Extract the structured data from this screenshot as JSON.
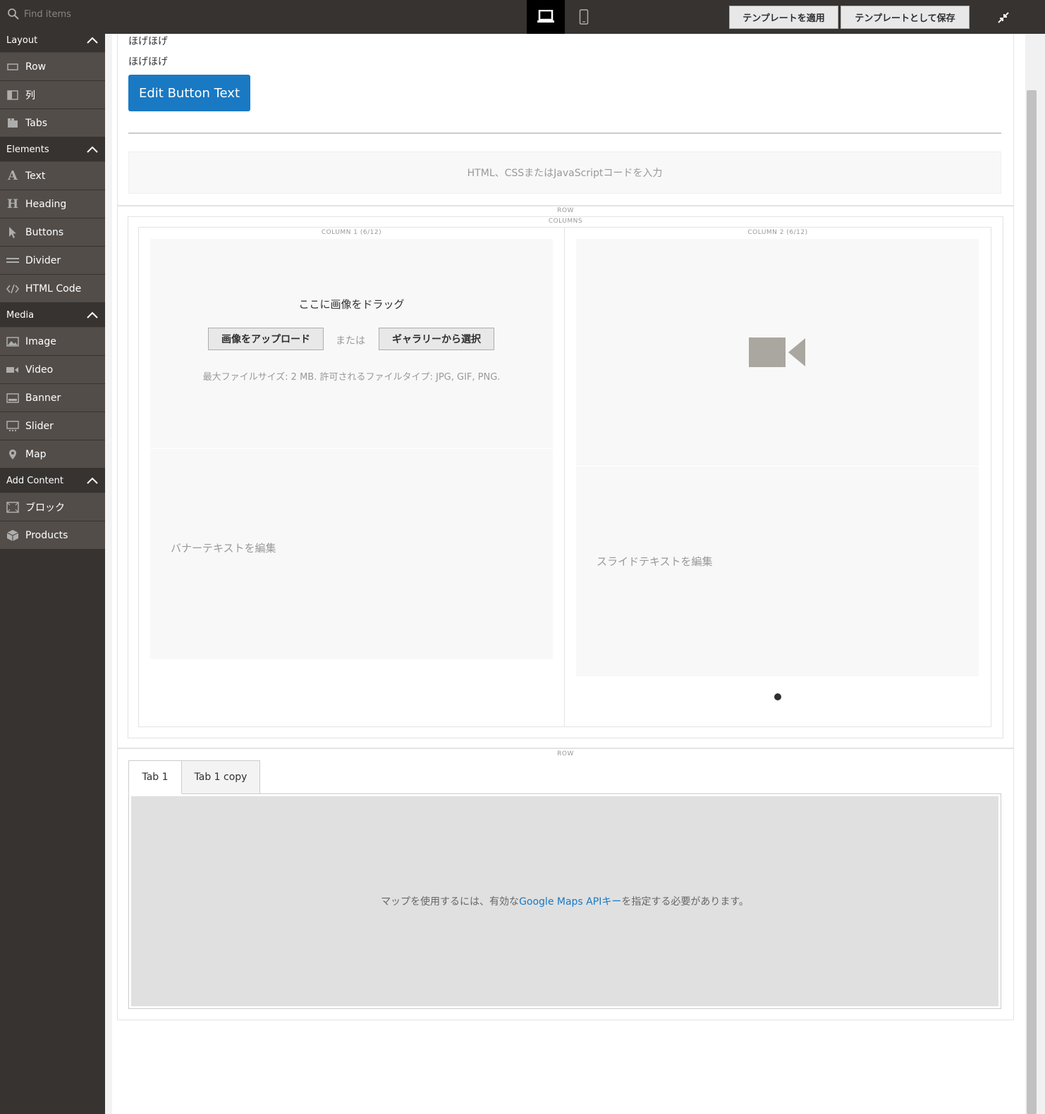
{
  "search": {
    "placeholder": "Find items"
  },
  "toolbar": {
    "apply_template": "テンプレートを適用",
    "save_as_template": "テンプレートとして保存"
  },
  "sidebar": {
    "groups": [
      {
        "label": "Layout",
        "items": [
          {
            "label": "Row",
            "icon": "row-icon"
          },
          {
            "label": "列",
            "icon": "column-icon"
          },
          {
            "label": "Tabs",
            "icon": "tabs-icon"
          }
        ]
      },
      {
        "label": "Elements",
        "items": [
          {
            "label": "Text",
            "icon": "text-icon"
          },
          {
            "label": "Heading",
            "icon": "heading-icon"
          },
          {
            "label": "Buttons",
            "icon": "cursor-icon"
          },
          {
            "label": "Divider",
            "icon": "divider-icon"
          },
          {
            "label": "HTML Code",
            "icon": "code-icon"
          }
        ]
      },
      {
        "label": "Media",
        "items": [
          {
            "label": "Image",
            "icon": "image-icon"
          },
          {
            "label": "Video",
            "icon": "video-icon"
          },
          {
            "label": "Banner",
            "icon": "banner-icon"
          },
          {
            "label": "Slider",
            "icon": "slider-icon"
          },
          {
            "label": "Map",
            "icon": "map-pin-icon"
          }
        ]
      },
      {
        "label": "Add Content",
        "items": [
          {
            "label": "ブロック",
            "icon": "block-icon"
          },
          {
            "label": "Products",
            "icon": "products-icon"
          }
        ]
      }
    ]
  },
  "stage": {
    "text_lines": [
      "ほげほげ",
      "ほげほげ"
    ],
    "button_text": "Edit Button Text",
    "html_placeholder": "HTML、CSSまたはJavaScriptコードを入力",
    "row_label": "ROW",
    "columns_label": "COLUMNS",
    "column1_label": "COLUMN 1 (6/12)",
    "column2_label": "COLUMN 2 (6/12)",
    "image": {
      "drag_text": "ここに画像をドラッグ",
      "upload_button": "画像をアップロード",
      "or_text": "または",
      "gallery_button": "ギャラリーから選択",
      "max_text": "最大ファイルサイズ: 2 MB. 許可されるファイルタイプ: JPG, GIF, PNG."
    },
    "banner_text": "バナーテキストを編集",
    "slide_text": "スライドテキストを編集",
    "row2_label": "ROW",
    "tabs": [
      "Tab 1",
      "Tab 1 copy"
    ],
    "map": {
      "prefix": "マップを使用するには、有効な",
      "link": "Google Maps APIキー",
      "suffix": "を指定する必要があります。"
    }
  },
  "colors": {
    "sidebar_bg": "#373330",
    "item_bg": "#524d49",
    "button_blue": "#1979c3"
  }
}
